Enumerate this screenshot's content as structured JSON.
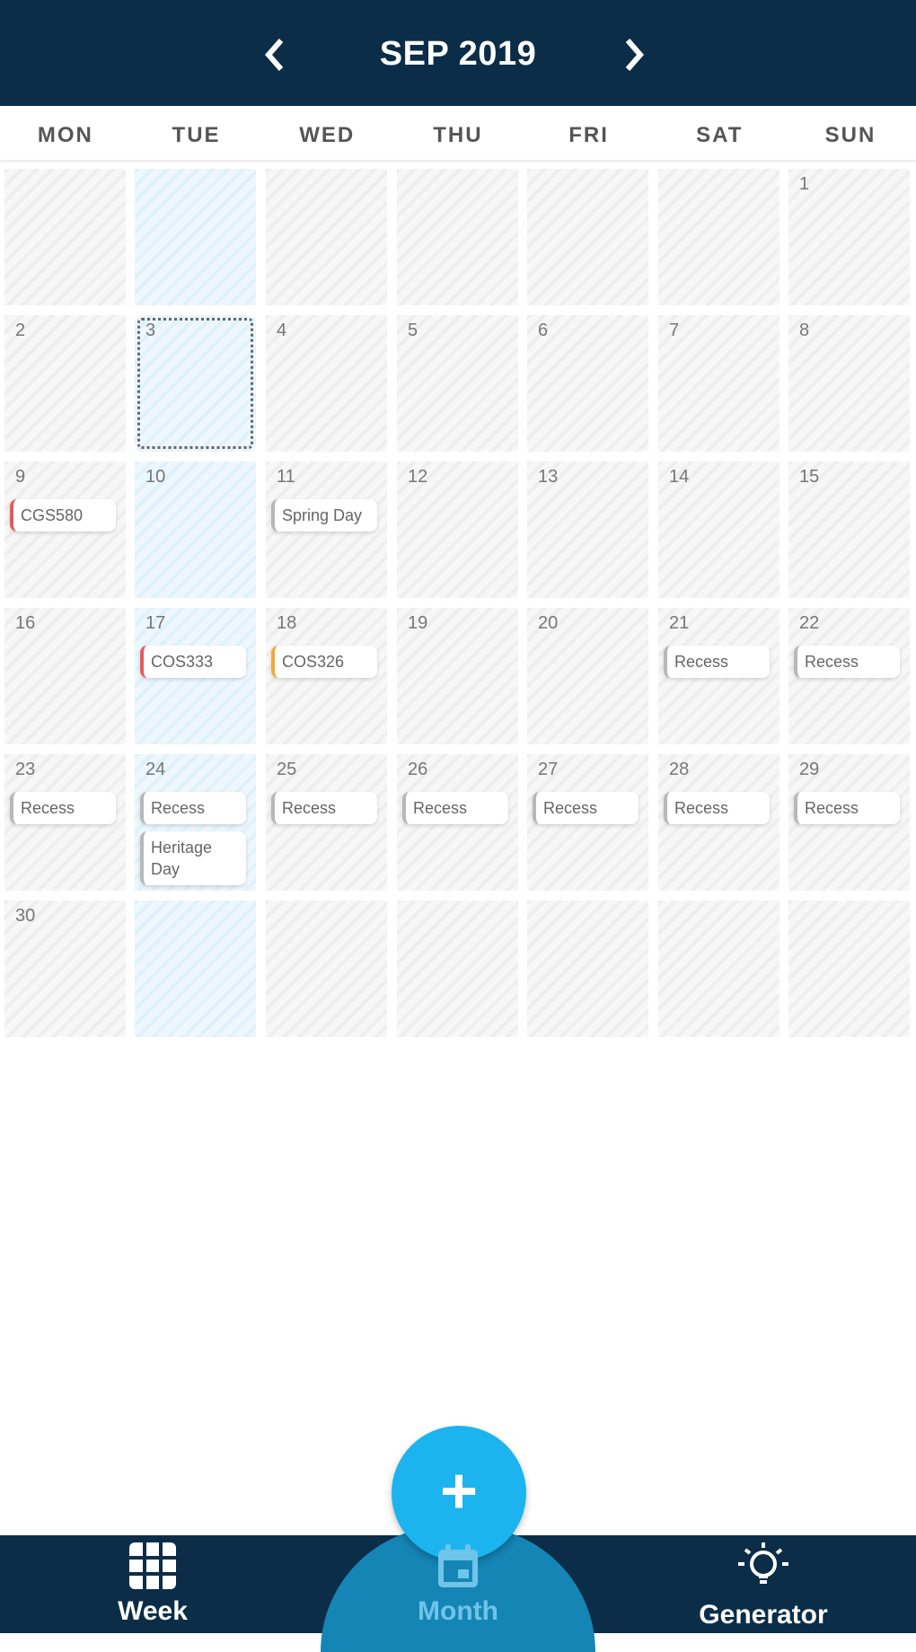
{
  "header": {
    "title": "SEP 2019",
    "prev_icon": "chevron-left-icon",
    "next_icon": "chevron-right-icon"
  },
  "weekdays": [
    "MON",
    "TUE",
    "WED",
    "THU",
    "FRI",
    "SAT",
    "SUN"
  ],
  "weeks": [
    {
      "days": [
        {
          "num": "",
          "events": []
        },
        {
          "num": "",
          "events": []
        },
        {
          "num": "",
          "events": []
        },
        {
          "num": "",
          "events": []
        },
        {
          "num": "",
          "events": []
        },
        {
          "num": "",
          "events": []
        },
        {
          "num": "1",
          "events": []
        }
      ]
    },
    {
      "days": [
        {
          "num": "2",
          "events": []
        },
        {
          "num": "3",
          "events": [],
          "today": true
        },
        {
          "num": "4",
          "events": []
        },
        {
          "num": "5",
          "events": []
        },
        {
          "num": "6",
          "events": []
        },
        {
          "num": "7",
          "events": []
        },
        {
          "num": "8",
          "events": []
        }
      ]
    },
    {
      "days": [
        {
          "num": "9",
          "events": [
            {
              "title": "CGS580",
              "color": "red"
            }
          ]
        },
        {
          "num": "10",
          "events": []
        },
        {
          "num": "11",
          "events": [
            {
              "title": "Spring Day",
              "color": "grey"
            }
          ]
        },
        {
          "num": "12",
          "events": []
        },
        {
          "num": "13",
          "events": []
        },
        {
          "num": "14",
          "events": []
        },
        {
          "num": "15",
          "events": []
        }
      ]
    },
    {
      "days": [
        {
          "num": "16",
          "events": []
        },
        {
          "num": "17",
          "events": [
            {
              "title": "COS333",
              "color": "red"
            }
          ]
        },
        {
          "num": "18",
          "events": [
            {
              "title": "COS326",
              "color": "orange"
            }
          ]
        },
        {
          "num": "19",
          "events": []
        },
        {
          "num": "20",
          "events": []
        },
        {
          "num": "21",
          "events": [
            {
              "title": "Recess",
              "color": "grey"
            }
          ]
        },
        {
          "num": "22",
          "events": [
            {
              "title": "Recess",
              "color": "grey"
            }
          ]
        }
      ]
    },
    {
      "days": [
        {
          "num": "23",
          "events": [
            {
              "title": "Recess",
              "color": "grey"
            }
          ]
        },
        {
          "num": "24",
          "events": [
            {
              "title": "Recess",
              "color": "grey"
            },
            {
              "title": "Heritage Day",
              "color": "grey"
            }
          ]
        },
        {
          "num": "25",
          "events": [
            {
              "title": "Recess",
              "color": "grey"
            }
          ]
        },
        {
          "num": "26",
          "events": [
            {
              "title": "Recess",
              "color": "grey"
            }
          ]
        },
        {
          "num": "27",
          "events": [
            {
              "title": "Recess",
              "color": "grey"
            }
          ]
        },
        {
          "num": "28",
          "events": [
            {
              "title": "Recess",
              "color": "grey"
            }
          ]
        },
        {
          "num": "29",
          "events": [
            {
              "title": "Recess",
              "color": "grey"
            }
          ]
        }
      ]
    },
    {
      "days": [
        {
          "num": "30",
          "events": []
        },
        {
          "num": "",
          "events": []
        },
        {
          "num": "",
          "events": []
        },
        {
          "num": "",
          "events": []
        },
        {
          "num": "",
          "events": []
        },
        {
          "num": "",
          "events": []
        },
        {
          "num": "",
          "events": []
        }
      ]
    }
  ],
  "fab": {
    "label": "+",
    "icon": "plus-icon"
  },
  "bottom_nav": {
    "week": {
      "label": "Week",
      "icon": "grid-icon"
    },
    "month": {
      "label": "Month",
      "icon": "calendar-icon",
      "active": true
    },
    "generator": {
      "label": "Generator",
      "icon": "lightbulb-icon"
    }
  },
  "colors": {
    "header_bg": "#0b2d48",
    "accent": "#1cb4ef",
    "event_red": "#e65a5a",
    "event_orange": "#f3a93a",
    "event_grey": "#b8b8b8"
  }
}
